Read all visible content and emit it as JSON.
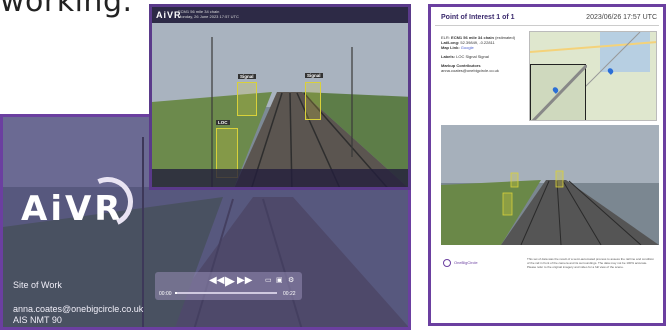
{
  "page": {
    "heading": "working."
  },
  "player": {
    "logo": "AiVR",
    "site_label": "Site of Work",
    "email": "anna.coates@onebigcircle.co.uk",
    "asset": "AIS NMT 90",
    "controls": {
      "rewind_icon": "rewind-icon",
      "play_icon": "play-icon",
      "forward_icon": "fast-forward-icon",
      "time_start": "00:00",
      "time_end": "00:22",
      "progress_fraction": 0.02
    }
  },
  "frame": {
    "logo": "AiVR",
    "title_line1": "ECM1 56 mile 34 chain",
    "title_line2": "Monday, 26 June 2023 17:57 UTC",
    "detections": [
      {
        "label": "Signal"
      },
      {
        "label": "Signal"
      },
      {
        "label": "LOC"
      }
    ]
  },
  "report": {
    "title_prefix": "Point of Interest",
    "title_index": "1 of 1",
    "date": "2023/06/26 17:57 UTC",
    "elr_label": "ELR:",
    "elr_value": "ECM1 56 mile 34 chain",
    "elr_note": "(estimated)",
    "latlong_label": "Lat/Long:",
    "latlong_value": "52.39849, -0.22811",
    "maplink_label": "Map Link:",
    "maplink_value": "Google",
    "labels_label": "Labels:",
    "labels_value": "LOC Signal Signal",
    "markup_label": "Markup Contributors",
    "markup_value": "anna.coates@onebigcircle.co.uk",
    "footer_name": "OneBigCircle",
    "disclaimer": "This set of data was the result of a semi-automated process to assess the rail line and condition of the rail in front of the camera and its surroundings. The data may not be 100% accurate. Please refer to the original imagery and video for a full view of the scene."
  }
}
